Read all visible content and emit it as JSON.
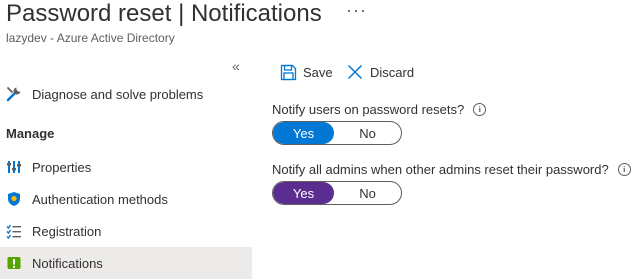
{
  "header": {
    "title": "Password reset | Notifications",
    "subtitle": "lazydev - Azure Active Directory",
    "more_label": "···"
  },
  "sidebar": {
    "collapse_label": "«",
    "top_item": {
      "label": "Diagnose and solve problems",
      "icon": "wrench-icon"
    },
    "section_label": "Manage",
    "items": [
      {
        "label": "Properties",
        "icon": "sliders-icon"
      },
      {
        "label": "Authentication methods",
        "icon": "shield-icon"
      },
      {
        "label": "Registration",
        "icon": "checklist-icon"
      },
      {
        "label": "Notifications",
        "icon": "notification-icon",
        "active": true
      }
    ]
  },
  "toolbar": {
    "save_label": "Save",
    "discard_label": "Discard"
  },
  "settings": {
    "notify_users": {
      "label": "Notify users on password resets?",
      "yes": "Yes",
      "no": "No",
      "selected": "Yes",
      "accent": "#0078d4"
    },
    "notify_admins": {
      "label": "Notify all admins when other admins reset their password?",
      "yes": "Yes",
      "no": "No",
      "selected": "Yes",
      "accent": "#5c2d91"
    }
  },
  "info_glyph": "i"
}
